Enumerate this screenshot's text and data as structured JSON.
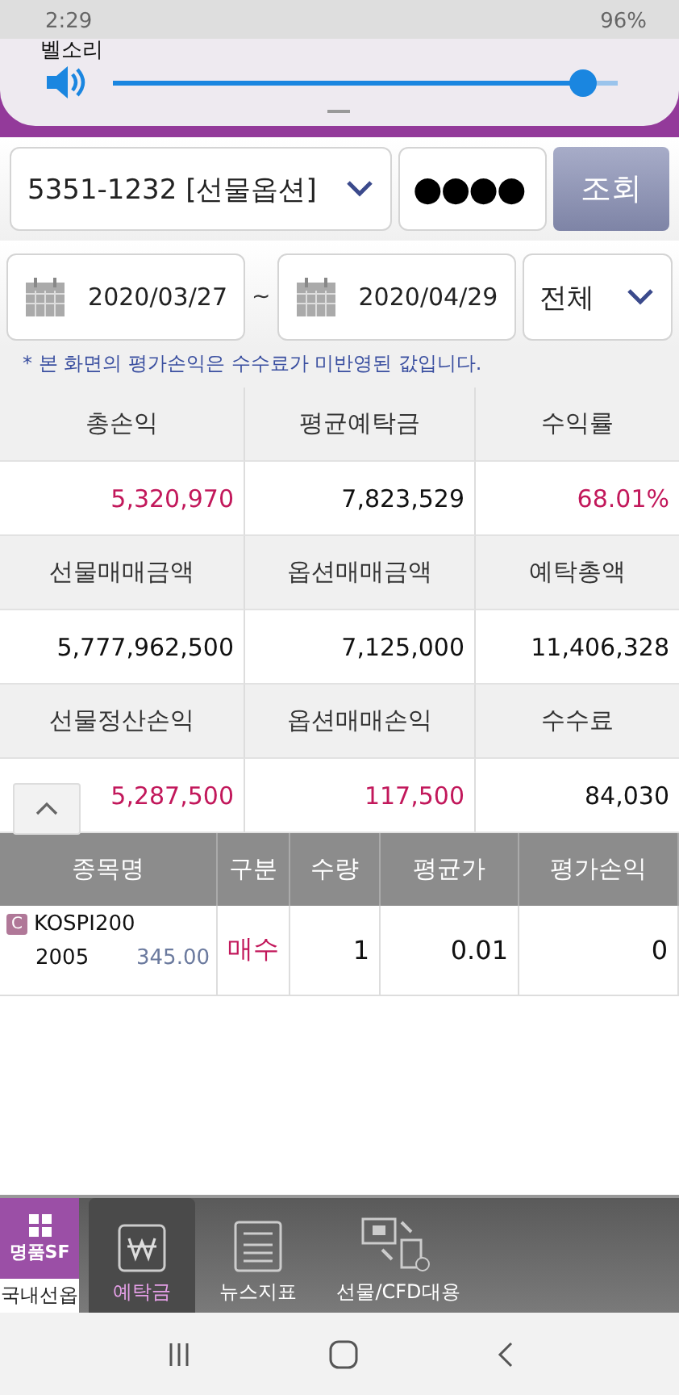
{
  "status_bar": {
    "time": "2:29",
    "battery": "96%"
  },
  "volume_panel": {
    "label": "벨소리",
    "level": 0.93
  },
  "account": {
    "value": "5351-1232 [선물옵션]",
    "password": "●●●●",
    "search_button": "조회"
  },
  "period": {
    "start": "2020/03/27",
    "separator": "~",
    "end": "2020/04/29",
    "filter": "전체"
  },
  "notice": "* 본 화면의 평가손익은 수수료가 미반영된 값입니다.",
  "summary": [
    {
      "headers": [
        "총손익",
        "평균예탁금",
        "수익률"
      ],
      "values": [
        {
          "text": "5,320,970",
          "highlighted": true
        },
        {
          "text": "7,823,529",
          "highlighted": false
        },
        {
          "text": "68.01%",
          "highlighted": true
        }
      ]
    },
    {
      "headers": [
        "선물매매금액",
        "옵션매매금액",
        "예탁총액"
      ],
      "values": [
        {
          "text": "5,777,962,500",
          "highlighted": false
        },
        {
          "text": "7,125,000",
          "highlighted": false
        },
        {
          "text": "11,406,328",
          "highlighted": false
        }
      ]
    },
    {
      "headers": [
        "선물정산손익",
        "옵션매매손익",
        "수수료"
      ],
      "values": [
        {
          "text": "5,287,500",
          "highlighted": true
        },
        {
          "text": "117,500",
          "highlighted": true
        },
        {
          "text": "84,030",
          "highlighted": false
        }
      ]
    }
  ],
  "holdings": {
    "columns": [
      "종목명",
      "구분",
      "수량",
      "평균가",
      "평가손익"
    ],
    "rows": [
      {
        "badge": "C",
        "name": "KOSPI200",
        "month": "2005",
        "strike": "345.00",
        "side": "매수",
        "quantity": "1",
        "average": "0.01",
        "pnl": "0"
      }
    ]
  },
  "toolbar": {
    "brand": "명품SF",
    "brand_caption": "국내선옵",
    "items": [
      {
        "kind": "deposit",
        "label": "예탁금",
        "selected": true
      },
      {
        "kind": "news",
        "label": "뉴스지표",
        "selected": false
      },
      {
        "kind": "transfer",
        "label": "선물/CFD대용",
        "selected": false
      }
    ]
  }
}
